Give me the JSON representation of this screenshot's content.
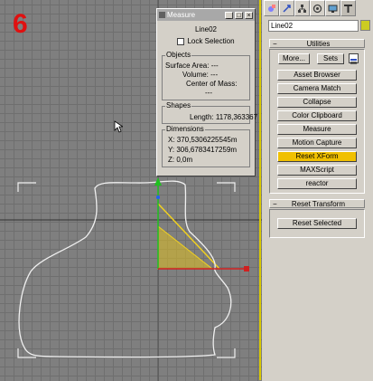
{
  "viewport": {
    "step_number": "6"
  },
  "measure_window": {
    "title": "Measure",
    "object_name": "Line02",
    "lock_selection_label": "Lock Selection",
    "objects_group": {
      "label": "Objects",
      "surface_area": "Surface Area:  ---",
      "volume": "Volume:  ---",
      "center_of_mass": "Center of Mass:",
      "center_of_mass_value": "---"
    },
    "shapes_group": {
      "label": "Shapes",
      "length": "Length: 1178,363367"
    },
    "dimensions_group": {
      "label": "Dimensions",
      "x": "X:  370,5306225545m",
      "y": "Y:  306,6783417259m",
      "z": "Z:  0,0m"
    },
    "window_buttons": [
      "_",
      "□",
      "×"
    ]
  },
  "command_panel": {
    "tab_icons": [
      "create-icon",
      "modify-icon",
      "hierarchy-icon",
      "motion-icon",
      "display-icon",
      "utilities-icon"
    ],
    "object_name": "Line02",
    "object_color": "#cccc22",
    "utilities": {
      "header": "Utilities",
      "more_label": "More...",
      "sets_label": "Sets",
      "buttons": [
        "Asset Browser",
        "Camera Match",
        "Collapse",
        "Color Clipboard",
        "Measure",
        "Motion Capture",
        "Reset XForm",
        "MAXScript",
        "reactor"
      ],
      "active_button": "Reset XForm"
    },
    "reset_transform": {
      "header": "Reset Transform",
      "reset_selected_label": "Reset Selected"
    }
  },
  "colors": {
    "viewport_bg": "#7f7f7f",
    "active_border": "#d8c800",
    "spline": "#f0f0f0",
    "selection_fill": "#e0c020",
    "active_button": "#f0c000"
  }
}
